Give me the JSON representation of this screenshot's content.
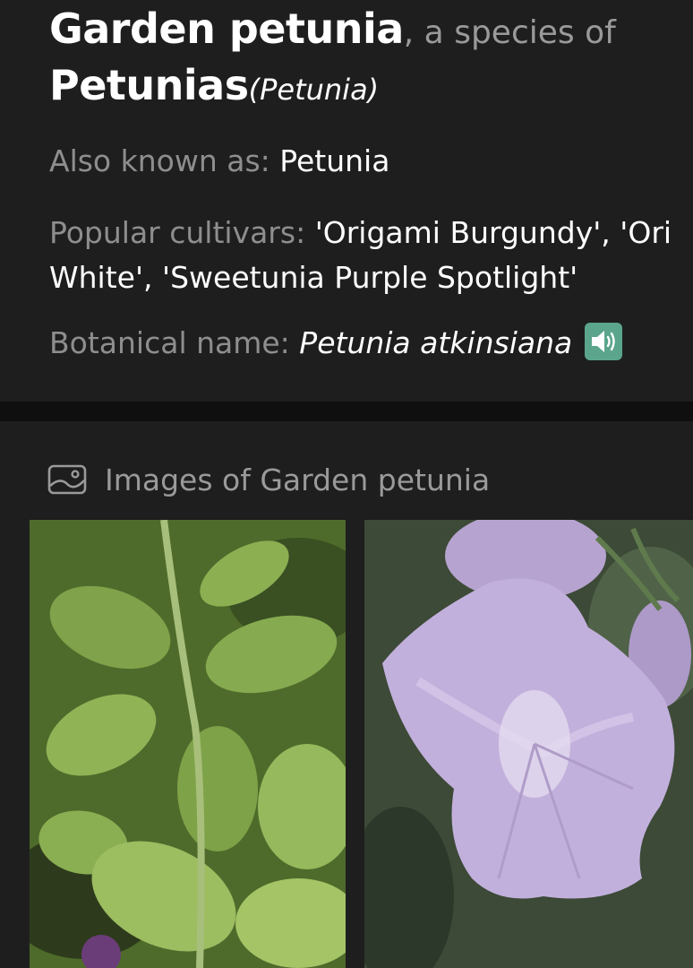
{
  "header": {
    "common_name": "Garden petunia",
    "species_connector": ", a species of",
    "genus": "Petunias",
    "genus_latin": "(Petunia)"
  },
  "details": {
    "aka_label": "Also known as: ",
    "aka_value": "Petunia",
    "cultivars_label": "Popular cultivars: ",
    "cultivars_line1": "'Origami Burgundy', 'Ori",
    "cultivars_line2": "White', 'Sweetunia Purple Spotlight'",
    "botanical_label": "Botanical name: ",
    "botanical_value": "Petunia atkinsiana",
    "audio_icon": "speaker-icon"
  },
  "images": {
    "heading": "Images of Garden petunia",
    "heading_icon": "gallery-icon",
    "items": [
      {
        "name": "petunia-foliage-image"
      },
      {
        "name": "petunia-flower-image"
      }
    ]
  },
  "colors": {
    "background": "#1c1c1c",
    "muted_text": "#8e8e8e",
    "audio_button": "#5aa58c"
  }
}
